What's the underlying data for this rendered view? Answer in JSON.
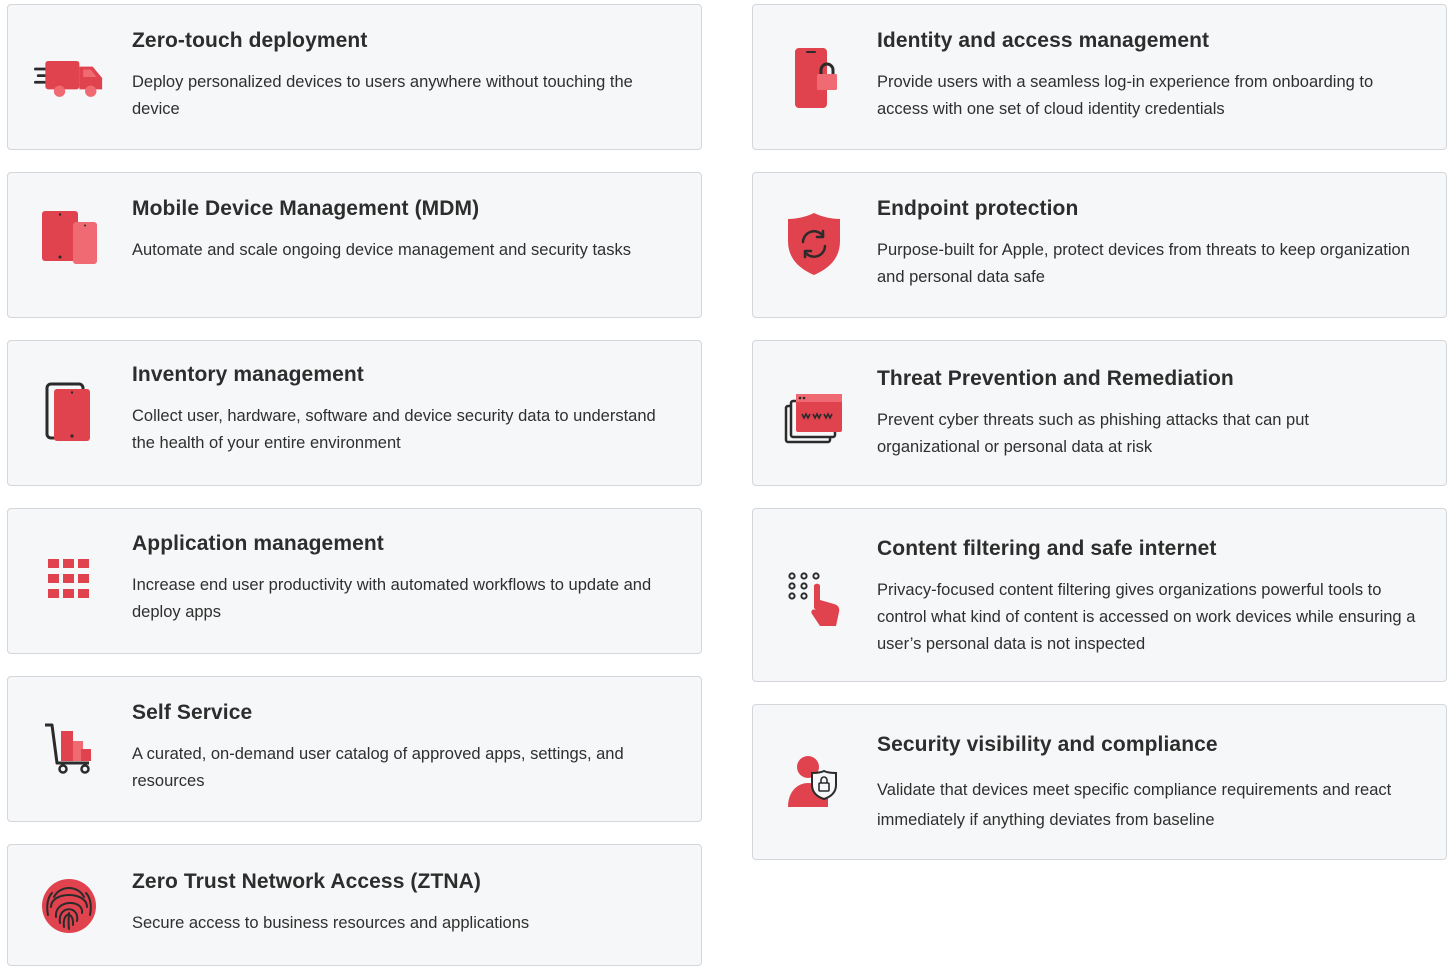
{
  "colors": {
    "accent": "#e0424e",
    "accent_light": "#ef6a73",
    "card_background": "#f6f7f8",
    "card_border": "#d3d6da",
    "dark_outline": "#2b2b2b"
  },
  "left_column": [
    {
      "icon": "delivery-truck-icon",
      "title": "Zero-touch deployment",
      "description": "Deploy personalized devices to users anywhere without touching the device"
    },
    {
      "icon": "devices-icon",
      "title": "Mobile Device Management (MDM)",
      "description": "Automate and scale ongoing device management and security tasks"
    },
    {
      "icon": "tablet-stack-icon",
      "title": "Inventory management",
      "description": "Collect user, hardware, software and device security data to understand the health of your entire environment"
    },
    {
      "icon": "app-grid-icon",
      "title": "Application management",
      "description": "Increase end user productivity with automated workflows to update and deploy apps"
    },
    {
      "icon": "shopping-cart-icon",
      "title": "Self Service",
      "description": "A curated, on-demand user catalog of approved apps, settings, and resources"
    },
    {
      "icon": "fingerprint-icon",
      "title": "Zero Trust Network Access (ZTNA)",
      "description": "Secure access to business resources and applications"
    }
  ],
  "right_column": [
    {
      "icon": "phone-lock-icon",
      "title": "Identity and access management",
      "description": "Provide users with a seamless log-in experience from onboarding to access with one set of cloud identity credentials"
    },
    {
      "icon": "shield-sync-icon",
      "title": "Endpoint protection",
      "description": "Purpose-built for Apple, protect devices from threats to keep organization and personal data safe"
    },
    {
      "icon": "browser-windows-icon",
      "title": "Threat Prevention and Remediation",
      "description": "Prevent cyber threats such as phishing attacks that can put organizational or personal data at risk"
    },
    {
      "icon": "touch-pointer-icon",
      "title": "Content filtering and safe internet",
      "description": "Privacy-focused content filtering gives organizations powerful tools to control what kind of content is accessed on work devices while ensuring a user’s personal data is not inspected"
    },
    {
      "icon": "user-shield-icon",
      "title": "Security visibility and compliance",
      "description": "Validate that devices meet specific compliance requirements and react immediately if anything deviates from baseline"
    }
  ]
}
